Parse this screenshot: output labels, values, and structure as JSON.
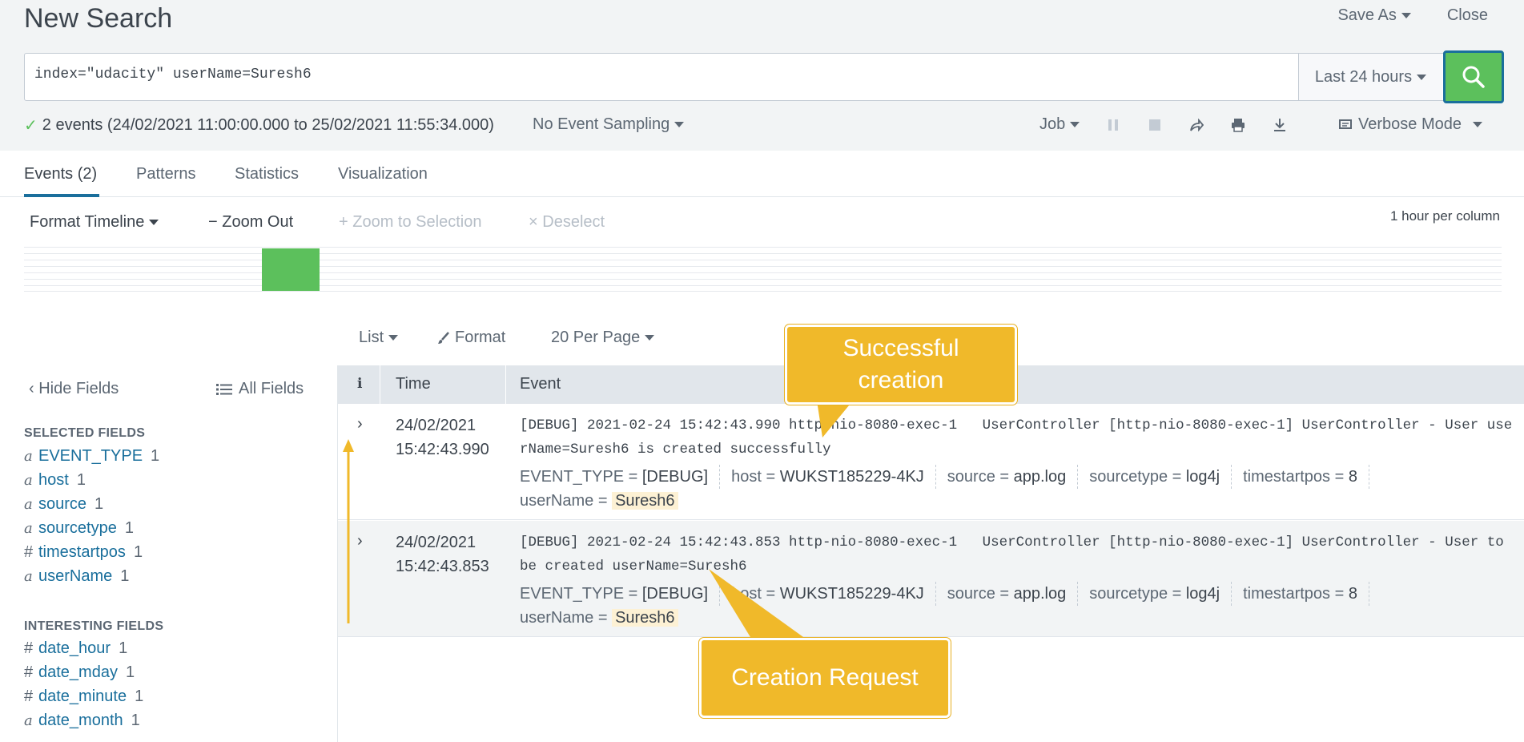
{
  "header": {
    "title": "New Search",
    "save_as": "Save As",
    "close": "Close"
  },
  "search": {
    "query": "index=\"udacity\" userName=Suresh6",
    "time_range": "Last 24 hours"
  },
  "status": {
    "summary": "2 events (24/02/2021 11:00:00.000 to 25/02/2021 11:55:34.000)",
    "sampling": "No Event Sampling",
    "job": "Job",
    "mode": "Verbose Mode"
  },
  "tabs": [
    {
      "label": "Events (2)"
    },
    {
      "label": "Patterns"
    },
    {
      "label": "Statistics"
    },
    {
      "label": "Visualization"
    }
  ],
  "timeline": {
    "format": "Format Timeline",
    "zoom_out": "Zoom Out",
    "zoom_selection": "Zoom to Selection",
    "deselect": "Deselect",
    "scale": "1 hour per column"
  },
  "results": {
    "list": "List",
    "format": "Format",
    "per_page": "20 Per Page"
  },
  "sidebar": {
    "hide_fields": "Hide Fields",
    "all_fields": "All Fields",
    "selected_title": "SELECTED FIELDS",
    "selected": [
      {
        "type": "a",
        "name": "EVENT_TYPE",
        "count": "1"
      },
      {
        "type": "a",
        "name": "host",
        "count": "1"
      },
      {
        "type": "a",
        "name": "source",
        "count": "1"
      },
      {
        "type": "a",
        "name": "sourcetype",
        "count": "1"
      },
      {
        "type": "#",
        "name": "timestartpos",
        "count": "1"
      },
      {
        "type": "a",
        "name": "userName",
        "count": "1"
      }
    ],
    "interesting_title": "INTERESTING FIELDS",
    "interesting": [
      {
        "type": "#",
        "name": "date_hour",
        "count": "1"
      },
      {
        "type": "#",
        "name": "date_mday",
        "count": "1"
      },
      {
        "type": "#",
        "name": "date_minute",
        "count": "1"
      },
      {
        "type": "a",
        "name": "date_month",
        "count": "1"
      }
    ]
  },
  "table": {
    "col_info": "i",
    "col_time": "Time",
    "col_event": "Event",
    "events": [
      {
        "date": "24/02/2021",
        "time": "15:42:43.990",
        "raw": "[DEBUG] 2021-02-24 15:42:43.990 http-nio-8080-exec-1   UserController [http-nio-8080-exec-1] UserController - User userName=Suresh6 is created successfully",
        "event_type_key": "EVENT_TYPE = ",
        "event_type": "[DEBUG]",
        "host_key": "host = ",
        "host": "WUKST185229-4KJ",
        "source_key": "source = ",
        "source": "app.log",
        "sourcetype_key": "sourcetype = ",
        "sourcetype": "log4j",
        "timestartpos_key": "timestartpos = ",
        "timestartpos": "8",
        "username_key": "userName = ",
        "username": "Suresh6"
      },
      {
        "date": "24/02/2021",
        "time": "15:42:43.853",
        "raw": "[DEBUG] 2021-02-24 15:42:43.853 http-nio-8080-exec-1   UserController [http-nio-8080-exec-1] UserController - User to be created userName=Suresh6",
        "event_type_key": "EVENT_TYPE = ",
        "event_type": "[DEBUG]",
        "host_key": "host = ",
        "host": "WUKST185229-4KJ",
        "source_key": "source = ",
        "source": "app.log",
        "sourcetype_key": "sourcetype = ",
        "sourcetype": "log4j",
        "timestartpos_key": "timestartpos = ",
        "timestartpos": "8",
        "username_key": "userName = ",
        "username": "Suresh6"
      }
    ]
  },
  "callouts": {
    "success": "Successful creation",
    "request": "Creation Request"
  },
  "colors": {
    "accent_green": "#5cc05c",
    "link_blue": "#1a6f9c",
    "callout_yellow": "#f0b92a"
  }
}
